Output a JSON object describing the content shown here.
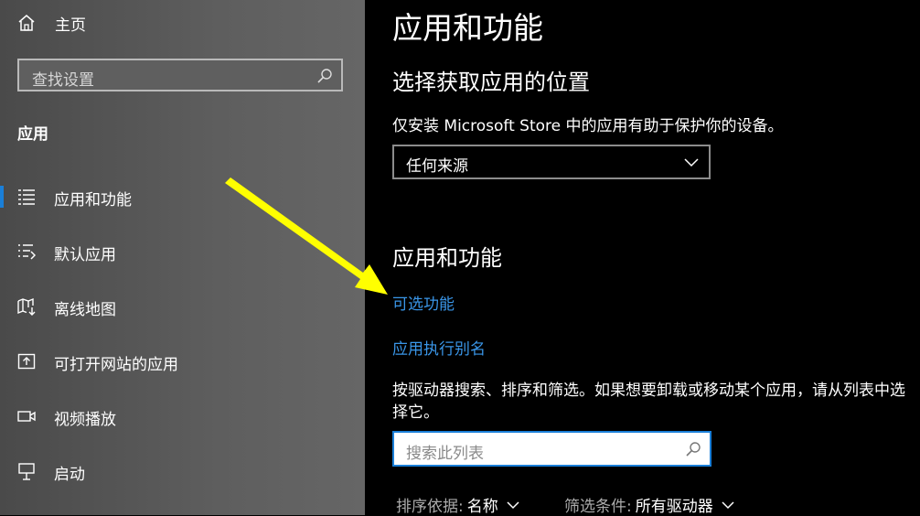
{
  "sidebar": {
    "home_label": "主页",
    "search_placeholder": "查找设置",
    "section_title": "应用",
    "items": [
      {
        "label": "应用和功能",
        "icon": "apps-features-icon",
        "active": true
      },
      {
        "label": "默认应用",
        "icon": "default-apps-icon"
      },
      {
        "label": "离线地图",
        "icon": "offline-maps-icon"
      },
      {
        "label": "可打开网站的应用",
        "icon": "apps-for-websites-icon"
      },
      {
        "label": "视频播放",
        "icon": "video-playback-icon"
      },
      {
        "label": "启动",
        "icon": "startup-icon"
      }
    ]
  },
  "main": {
    "title": "应用和功能",
    "choose_heading": "选择获取应用的位置",
    "choose_desc": "仅安装 Microsoft Store 中的应用有助于保护你的设备。",
    "source_value": "任何来源",
    "apps_heading": "应用和功能",
    "link_optional": "可选功能",
    "link_alias": "应用执行别名",
    "list_desc": "按驱动器搜索、排序和筛选。如果想要卸载或移动某个应用，请从列表中选择它。",
    "list_search_placeholder": "搜索此列表",
    "sort_key": "排序依据:",
    "sort_value": "名称",
    "filter_key": "筛选条件:",
    "filter_value": "所有驱动器"
  },
  "colors": {
    "accent": "#1a7fd8",
    "link": "#3a96e8",
    "annotation_arrow": "#ffff00"
  }
}
